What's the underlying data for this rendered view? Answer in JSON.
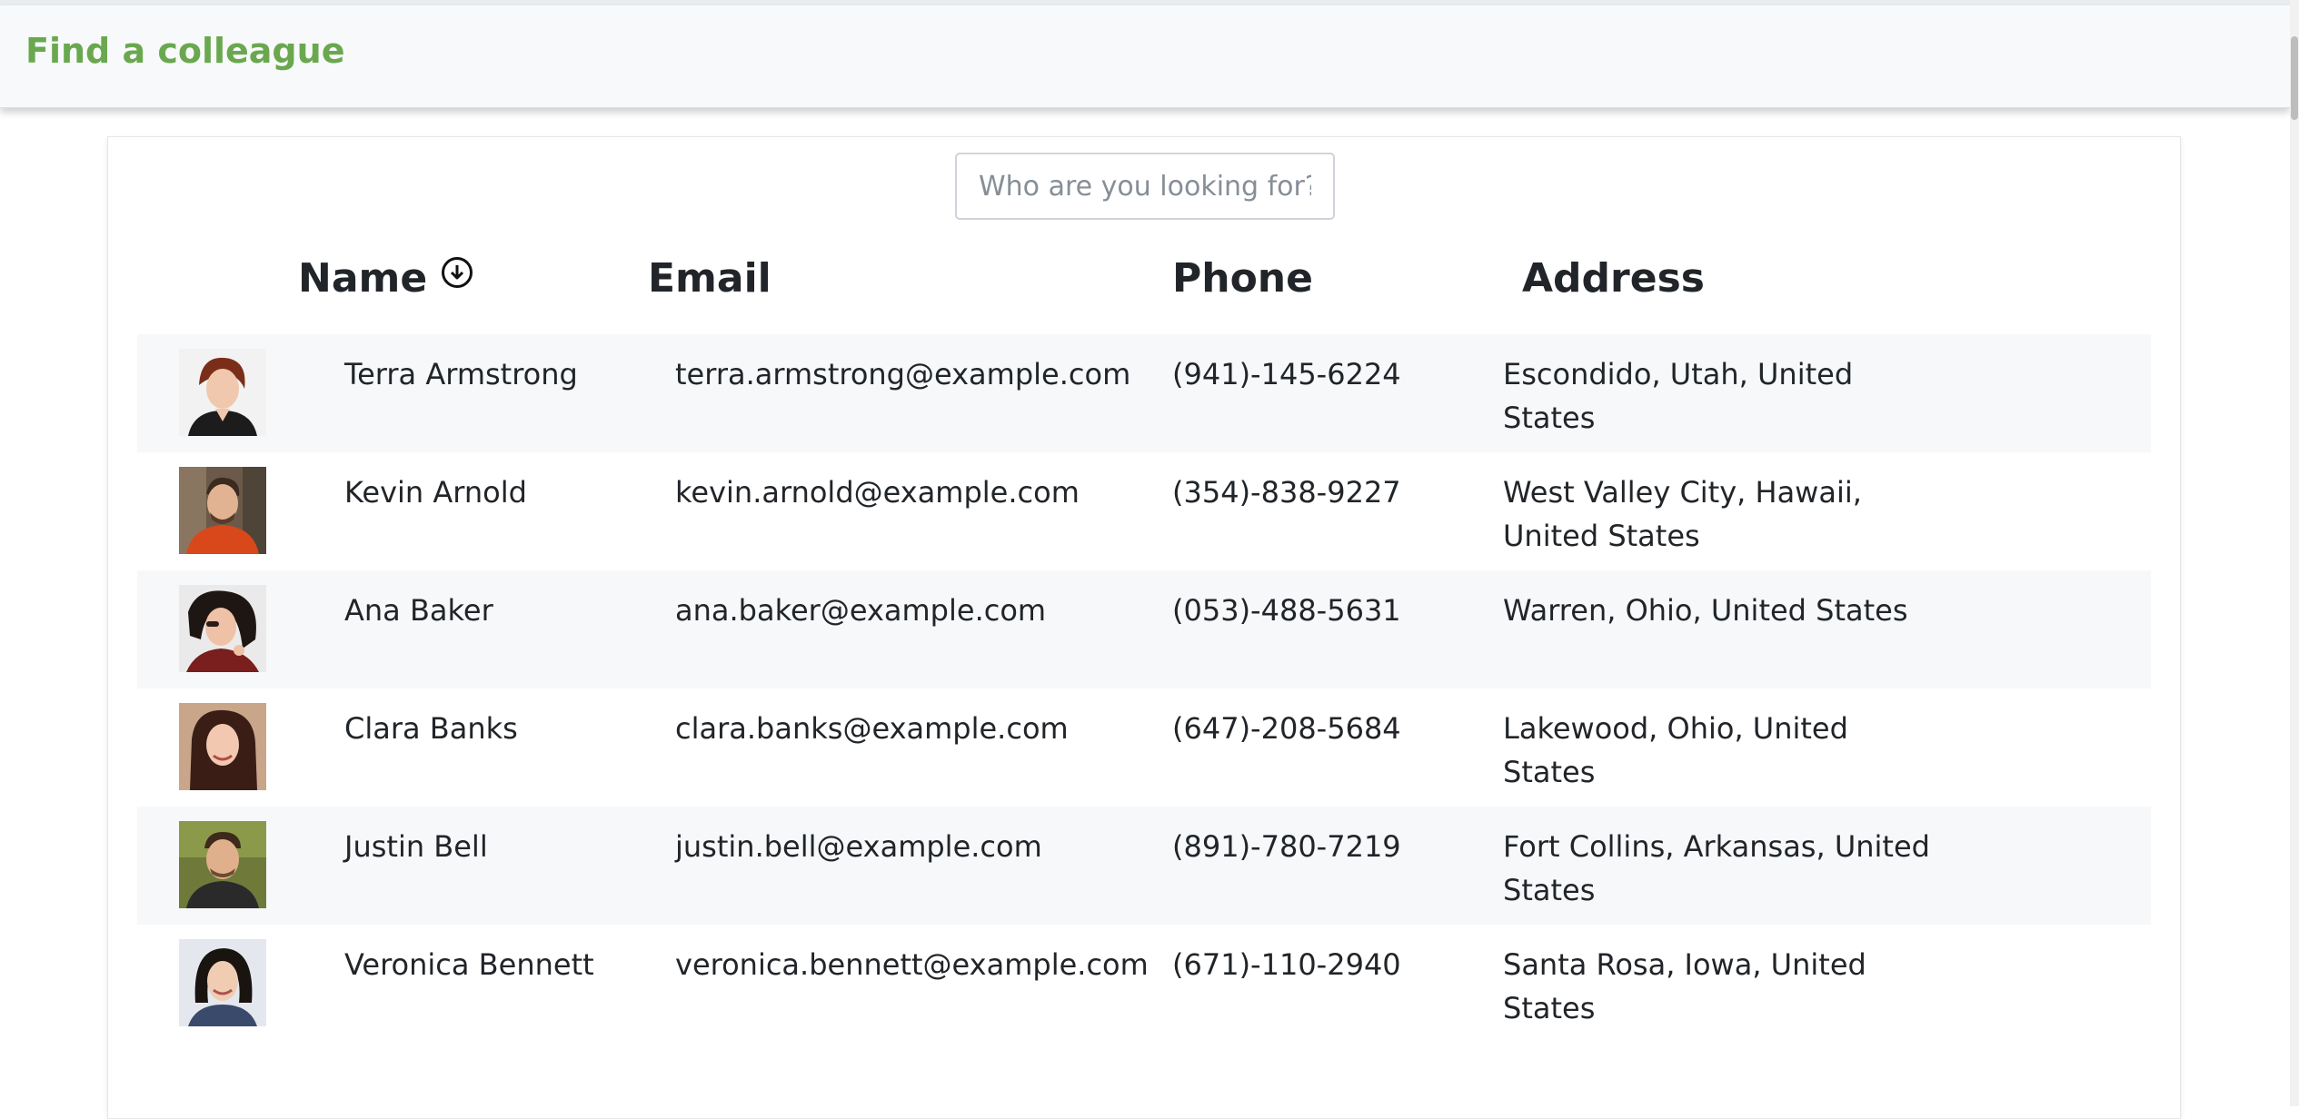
{
  "app": {
    "brand": "Find a colleague"
  },
  "search": {
    "placeholder": "Who are you looking for?",
    "value": ""
  },
  "table": {
    "headers": {
      "name": "Name",
      "email": "Email",
      "phone": "Phone",
      "address": "Address"
    },
    "sort_icon": "arrow-down-circle-icon",
    "rows": [
      {
        "name": "Terra Armstrong",
        "email": "terra.armstrong@example.com",
        "phone": "(941)-145-6224",
        "address": "Escondido, Utah, United States"
      },
      {
        "name": "Kevin Arnold",
        "email": "kevin.arnold@example.com",
        "phone": "(354)-838-9227",
        "address": "West Valley City, Hawaii, United States"
      },
      {
        "name": "Ana Baker",
        "email": "ana.baker@example.com",
        "phone": "(053)-488-5631",
        "address": "Warren, Ohio, United States"
      },
      {
        "name": "Clara Banks",
        "email": "clara.banks@example.com",
        "phone": "(647)-208-5684",
        "address": "Lakewood, Ohio, United States"
      },
      {
        "name": "Justin Bell",
        "email": "justin.bell@example.com",
        "phone": "(891)-780-7219",
        "address": "Fort Collins, Arkansas, United States"
      },
      {
        "name": "Veronica Bennett",
        "email": "veronica.bennett@example.com",
        "phone": "(671)-110-2940",
        "address": "Santa Rosa, Iowa, United States"
      }
    ]
  },
  "colors": {
    "brand": "#6aa84f",
    "stripe": "#f7f8f9"
  }
}
